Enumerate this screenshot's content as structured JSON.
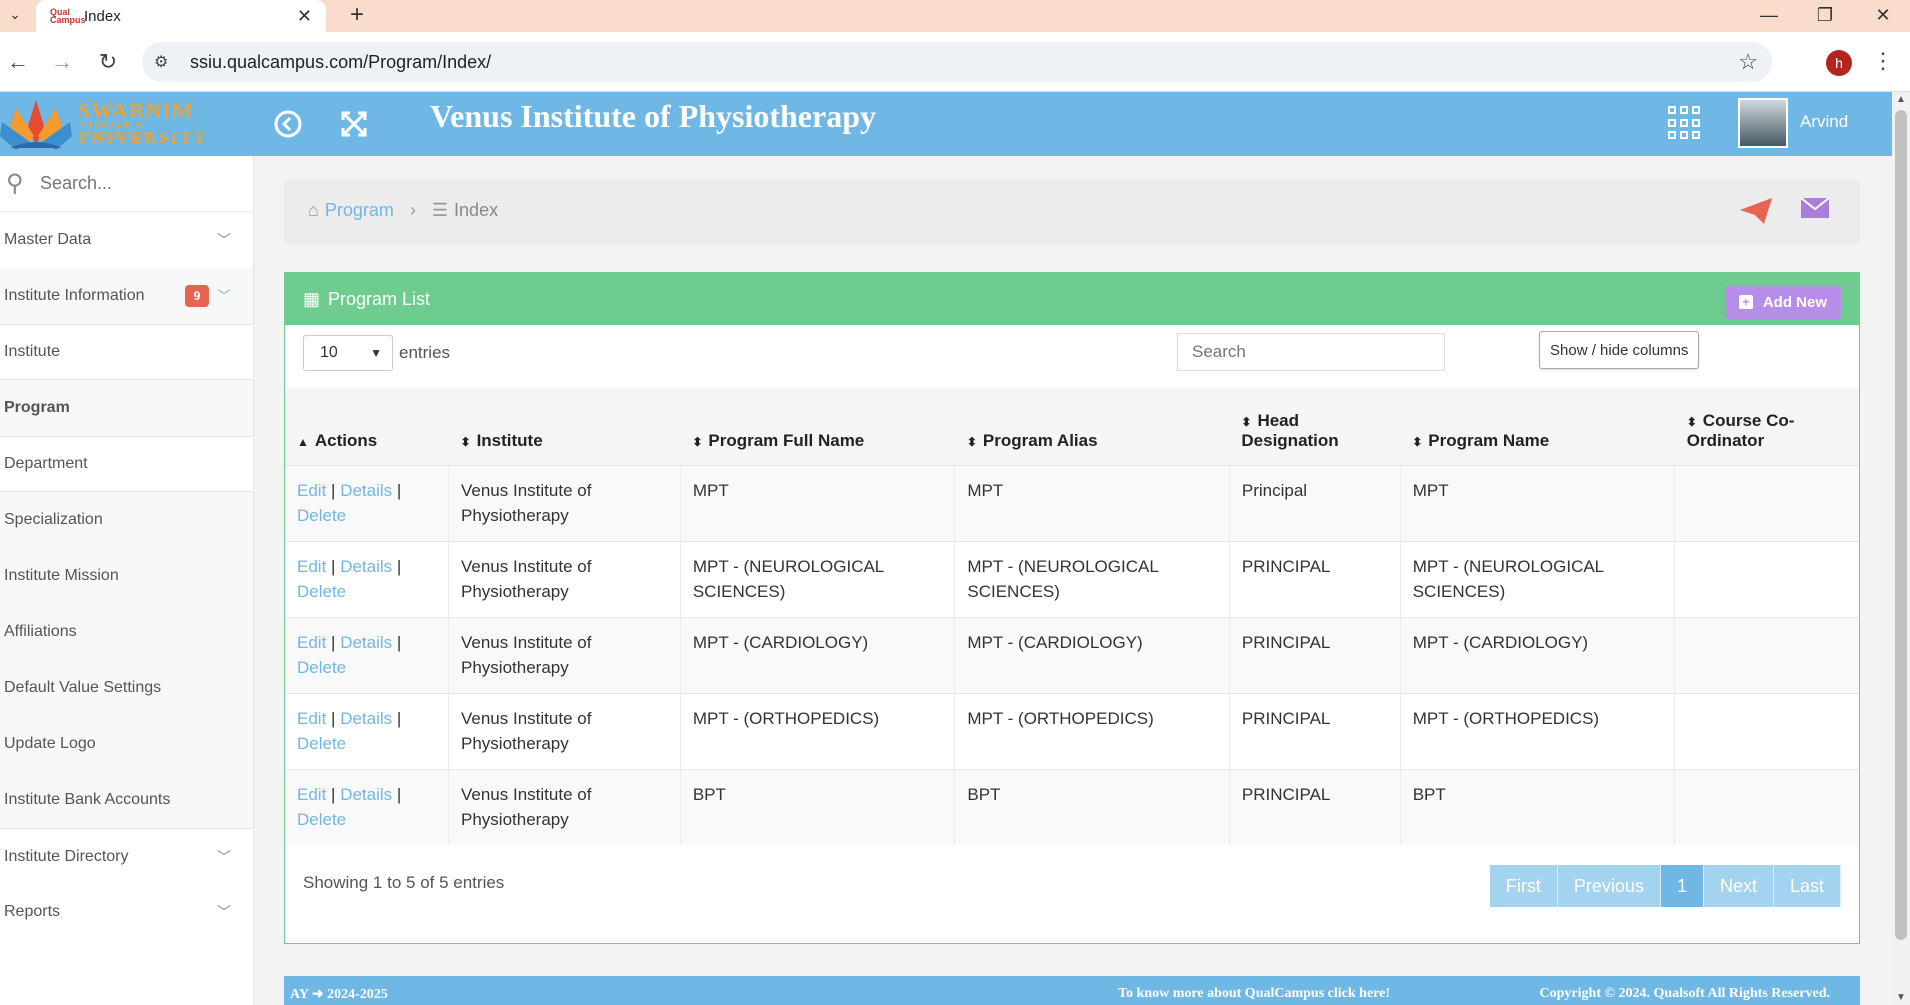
{
  "browser": {
    "tab_title": "Index",
    "favicon_text": "Qual Campus",
    "url": "ssiu.qualcampus.com/Program/Index/",
    "profile_initial": "h"
  },
  "header": {
    "logo_line1": "SWARNIM",
    "logo_line2": "STARTUP & INNOVATION",
    "logo_line3": "UNIVERSITY",
    "institute_title": "Venus Institute of Physiotherapy",
    "user_name": "Arvind"
  },
  "sidebar": {
    "search_placeholder": "Search...",
    "items": [
      {
        "label": "Master Data"
      },
      {
        "label": "Institute Information",
        "badge": "9"
      },
      {
        "label": "Institute"
      },
      {
        "label": "Program"
      },
      {
        "label": "Department"
      },
      {
        "label": "Specialization"
      },
      {
        "label": "Institute Mission"
      },
      {
        "label": "Affiliations"
      },
      {
        "label": "Default Value Settings"
      },
      {
        "label": "Update Logo"
      },
      {
        "label": "Institute Bank Accounts"
      },
      {
        "label": "Institute Directory"
      },
      {
        "label": "Reports"
      }
    ]
  },
  "breadcrumb": {
    "parent": "Program",
    "current": "Index"
  },
  "panel": {
    "title": "Program List",
    "add_new": "Add New",
    "entries_value": "10",
    "entries_label": "entries",
    "search_placeholder": "Search",
    "show_hide": "Show / hide columns",
    "columns": [
      "Actions",
      "Institute",
      "Program Full Name",
      "Program Alias",
      "Head Designation",
      "Program Name",
      "Course Co-Ordinator"
    ],
    "action_labels": {
      "edit": "Edit",
      "details": "Details",
      "delete": "Delete",
      "sep": "|"
    },
    "rows": [
      {
        "institute": "Venus Institute of Physiotherapy",
        "full_name": "MPT",
        "alias": "MPT",
        "head": "Principal",
        "name": "MPT",
        "coordinator": ""
      },
      {
        "institute": "Venus Institute of Physiotherapy",
        "full_name": "MPT - (NEUROLOGICAL SCIENCES)",
        "alias": "MPT - (NEUROLOGICAL SCIENCES)",
        "head": "PRINCIPAL",
        "name": "MPT - (NEUROLOGICAL SCIENCES)",
        "coordinator": ""
      },
      {
        "institute": "Venus Institute of Physiotherapy",
        "full_name": "MPT - (CARDIOLOGY)",
        "alias": "MPT - (CARDIOLOGY)",
        "head": "PRINCIPAL",
        "name": "MPT - (CARDIOLOGY)",
        "coordinator": ""
      },
      {
        "institute": "Venus Institute of Physiotherapy",
        "full_name": "MPT - (ORTHOPEDICS)",
        "alias": "MPT - (ORTHOPEDICS)",
        "head": "PRINCIPAL",
        "name": "MPT - (ORTHOPEDICS)",
        "coordinator": ""
      },
      {
        "institute": "Venus Institute of Physiotherapy",
        "full_name": "BPT",
        "alias": "BPT",
        "head": "PRINCIPAL",
        "name": "BPT",
        "coordinator": ""
      }
    ],
    "showing_text": "Showing 1 to 5 of 5 entries",
    "pager": [
      "First",
      "Previous",
      "1",
      "Next",
      "Last"
    ]
  },
  "footer": {
    "ay": "AY ➜ 2024-2025",
    "know_more": "To know more about QualCampus click here!",
    "copyright": "Copyright © 2024. Qualsoft All Rights Reserved."
  },
  "colors": {
    "header_blue": "#6fb7e4",
    "panel_green": "#6dcc8e",
    "add_new_purple": "#b68de8",
    "badge_red": "#e86452"
  }
}
